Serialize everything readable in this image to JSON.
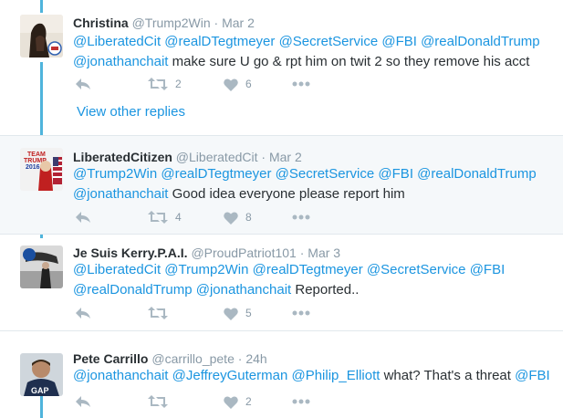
{
  "colors": {
    "link": "#1b95e0",
    "muted": "#8899a6",
    "thread": "#4fb4dc",
    "highlight": "#f5f8fa"
  },
  "tweets": [
    {
      "name": "Christina",
      "handle": "@Trump2Win",
      "dot": "·",
      "time": "Mar 2",
      "line1": [
        "@LiberatedCit",
        "@realDTegtmeyer",
        "@SecretService",
        "@FBI",
        "@realDonaldTrump"
      ],
      "line2_mention": "@jonathanchait",
      "line2_text": "make sure U go & rpt him on twit 2 so they remove his acct",
      "retweets": "2",
      "likes": "6"
    },
    {
      "name": "LiberatedCitizen",
      "handle": "@LiberatedCit",
      "dot": "·",
      "time": "Mar 2",
      "line1": [
        "@Trump2Win",
        "@realDTegtmeyer",
        "@SecretService",
        "@FBI",
        "@realDonaldTrump"
      ],
      "line2_mention": "@jonathanchait",
      "line2_text": "Good idea everyone please report him",
      "retweets": "4",
      "likes": "8"
    },
    {
      "name": "Je Suis Kerry.P.A.I.",
      "handle": "@ProudPatriot101",
      "dot": "·",
      "time": "Mar 3",
      "line1": [
        "@LiberatedCit",
        "@Trump2Win",
        "@realDTegtmeyer",
        "@SecretService",
        "@FBI"
      ],
      "line2_mentions": [
        "@realDonaldTrump",
        "@jonathanchait"
      ],
      "line2_text": "Reported..",
      "retweets": "",
      "likes": "5"
    },
    {
      "name": "Pete Carrillo",
      "handle": "@carrillo_pete",
      "dot": "·",
      "time": "24h",
      "line1": [
        "@jonathanchait",
        "@JeffreyGuterman",
        "@Philip_Elliott"
      ],
      "line1_text": "what? That's a threat",
      "line1_end": "@FBI",
      "retweets": "",
      "likes": "2"
    }
  ],
  "view_other_replies": "View other replies",
  "avatar4_shirt": "GAP"
}
